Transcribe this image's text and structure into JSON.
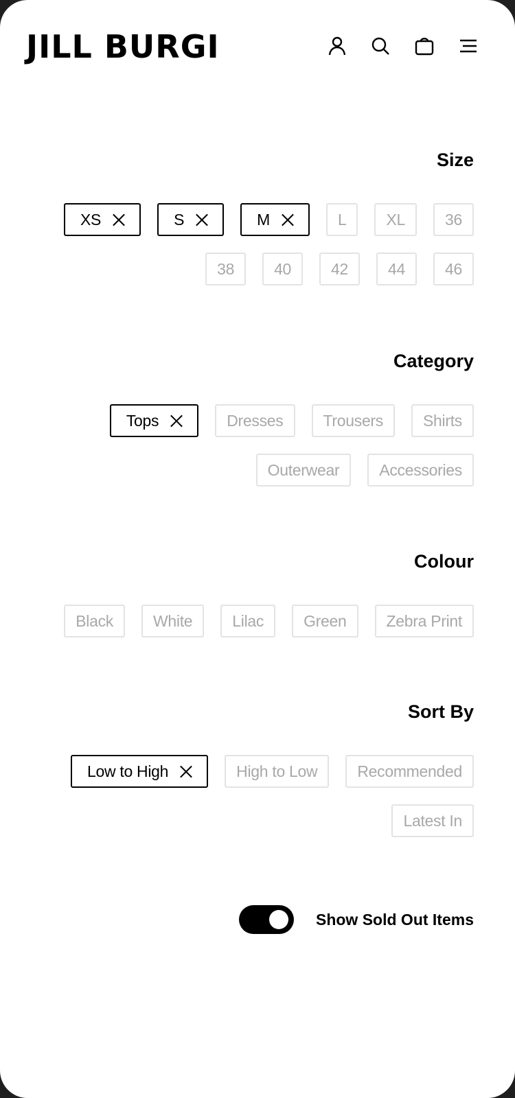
{
  "header": {
    "logo": "JILL BURGI",
    "icons": [
      "account-icon",
      "search-icon",
      "bag-icon",
      "menu-icon"
    ]
  },
  "filters": {
    "size": {
      "title": "Size",
      "options": [
        {
          "label": "XS",
          "selected": true
        },
        {
          "label": "S",
          "selected": true
        },
        {
          "label": "M",
          "selected": true
        },
        {
          "label": "L",
          "selected": false
        },
        {
          "label": "XL",
          "selected": false
        },
        {
          "label": "36",
          "selected": false
        },
        {
          "label": "38",
          "selected": false
        },
        {
          "label": "40",
          "selected": false
        },
        {
          "label": "42",
          "selected": false
        },
        {
          "label": "44",
          "selected": false
        },
        {
          "label": "46",
          "selected": false
        }
      ]
    },
    "category": {
      "title": "Category",
      "options": [
        {
          "label": "Tops",
          "selected": true
        },
        {
          "label": "Dresses",
          "selected": false
        },
        {
          "label": "Trousers",
          "selected": false
        },
        {
          "label": "Shirts",
          "selected": false
        },
        {
          "label": "Outerwear",
          "selected": false
        },
        {
          "label": "Accessories",
          "selected": false
        }
      ]
    },
    "colour": {
      "title": "Colour",
      "options": [
        {
          "label": "Black",
          "selected": false
        },
        {
          "label": "White",
          "selected": false
        },
        {
          "label": "Lilac",
          "selected": false
        },
        {
          "label": "Green",
          "selected": false
        },
        {
          "label": "Zebra Print",
          "selected": false
        }
      ]
    },
    "sort": {
      "title": "Sort By",
      "options": [
        {
          "label": "Low to High",
          "selected": true
        },
        {
          "label": "High to Low",
          "selected": false
        },
        {
          "label": "Recommended",
          "selected": false
        },
        {
          "label": "Latest In",
          "selected": false
        }
      ]
    }
  },
  "sold_out_toggle": {
    "label": "Show Sold Out Items",
    "on": true
  },
  "colors": {
    "background": "#ffffff",
    "text": "#000000",
    "inactive_text": "#a8a8a8",
    "inactive_border": "#e3e3e3"
  }
}
